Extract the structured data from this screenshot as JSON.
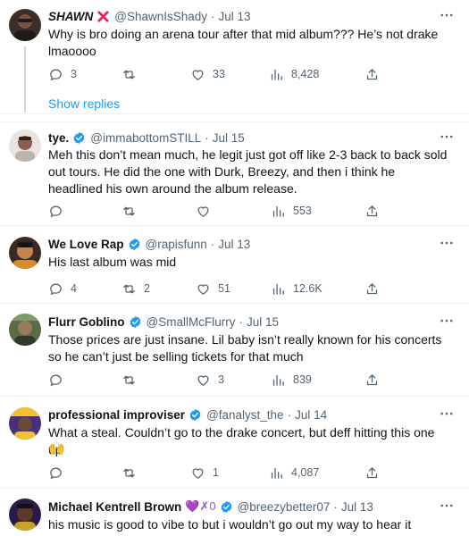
{
  "tweets": [
    {
      "name": "SHAWN",
      "name_suffix_icon": "red-x-emoji",
      "handle": "@ShawnIsShady",
      "date": "Jul 13",
      "verified": false,
      "text": "Why is bro doing an arena tour after that mid album??? He’s not drake lmaoooo",
      "replies": "3",
      "retweets": "",
      "likes": "33",
      "views": "8,428",
      "show_replies": "Show replies"
    },
    {
      "name": "tye.",
      "handle": "@immabottomSTILL",
      "date": "Jul 15",
      "verified": true,
      "text": "Meh this don’t mean much, he legit just got off like 2-3 back to back sold out tours. He did the one with Durk, Breezy, and then i think he headlined his own around the album release.",
      "replies": "",
      "retweets": "",
      "likes": "",
      "views": "553"
    },
    {
      "name": "We Love Rap",
      "handle": "@rapisfunn",
      "date": "Jul 13",
      "verified": true,
      "text": "His last album was mid",
      "replies": "4",
      "retweets": "2",
      "likes": "51",
      "views": "12.6K"
    },
    {
      "name": "Flurr Goblino",
      "handle": "@SmallMcFlurry",
      "date": "Jul 15",
      "verified": true,
      "text": "Those prices are just insane. Lil baby isn’t really known for his concerts so he can’t just be selling tickets for that much",
      "replies": "",
      "retweets": "",
      "likes": "3",
      "views": "839"
    },
    {
      "name": "professional improviser",
      "handle": "@fanalyst_the",
      "date": "Jul 14",
      "verified": true,
      "text": "What a steal. Couldn’t go to the drake concert, but deff hitting this one up",
      "emoji": "🙌",
      "replies": "",
      "retweets": "",
      "likes": "1",
      "views": "4,087"
    },
    {
      "name": "Michael Kentrell Brown",
      "name_suffix": "💜✗0",
      "handle": "@breezybetter07",
      "date": "Jul 13",
      "verified": true,
      "text": "his music is good to vibe to but i wouldn’t go out my way to hear it"
    }
  ],
  "colors": {
    "accent": "#1d9bf0",
    "secondary_text": "#536471",
    "divider": "#eff3f4",
    "verified": "#1d9bf0",
    "red_x": "#e0245e"
  },
  "icons": {
    "reply": "reply-icon",
    "retweet": "retweet-icon",
    "like": "heart-icon",
    "views": "views-icon",
    "share": "share-icon",
    "more": "more-icon",
    "verified": "verified-badge-icon"
  }
}
